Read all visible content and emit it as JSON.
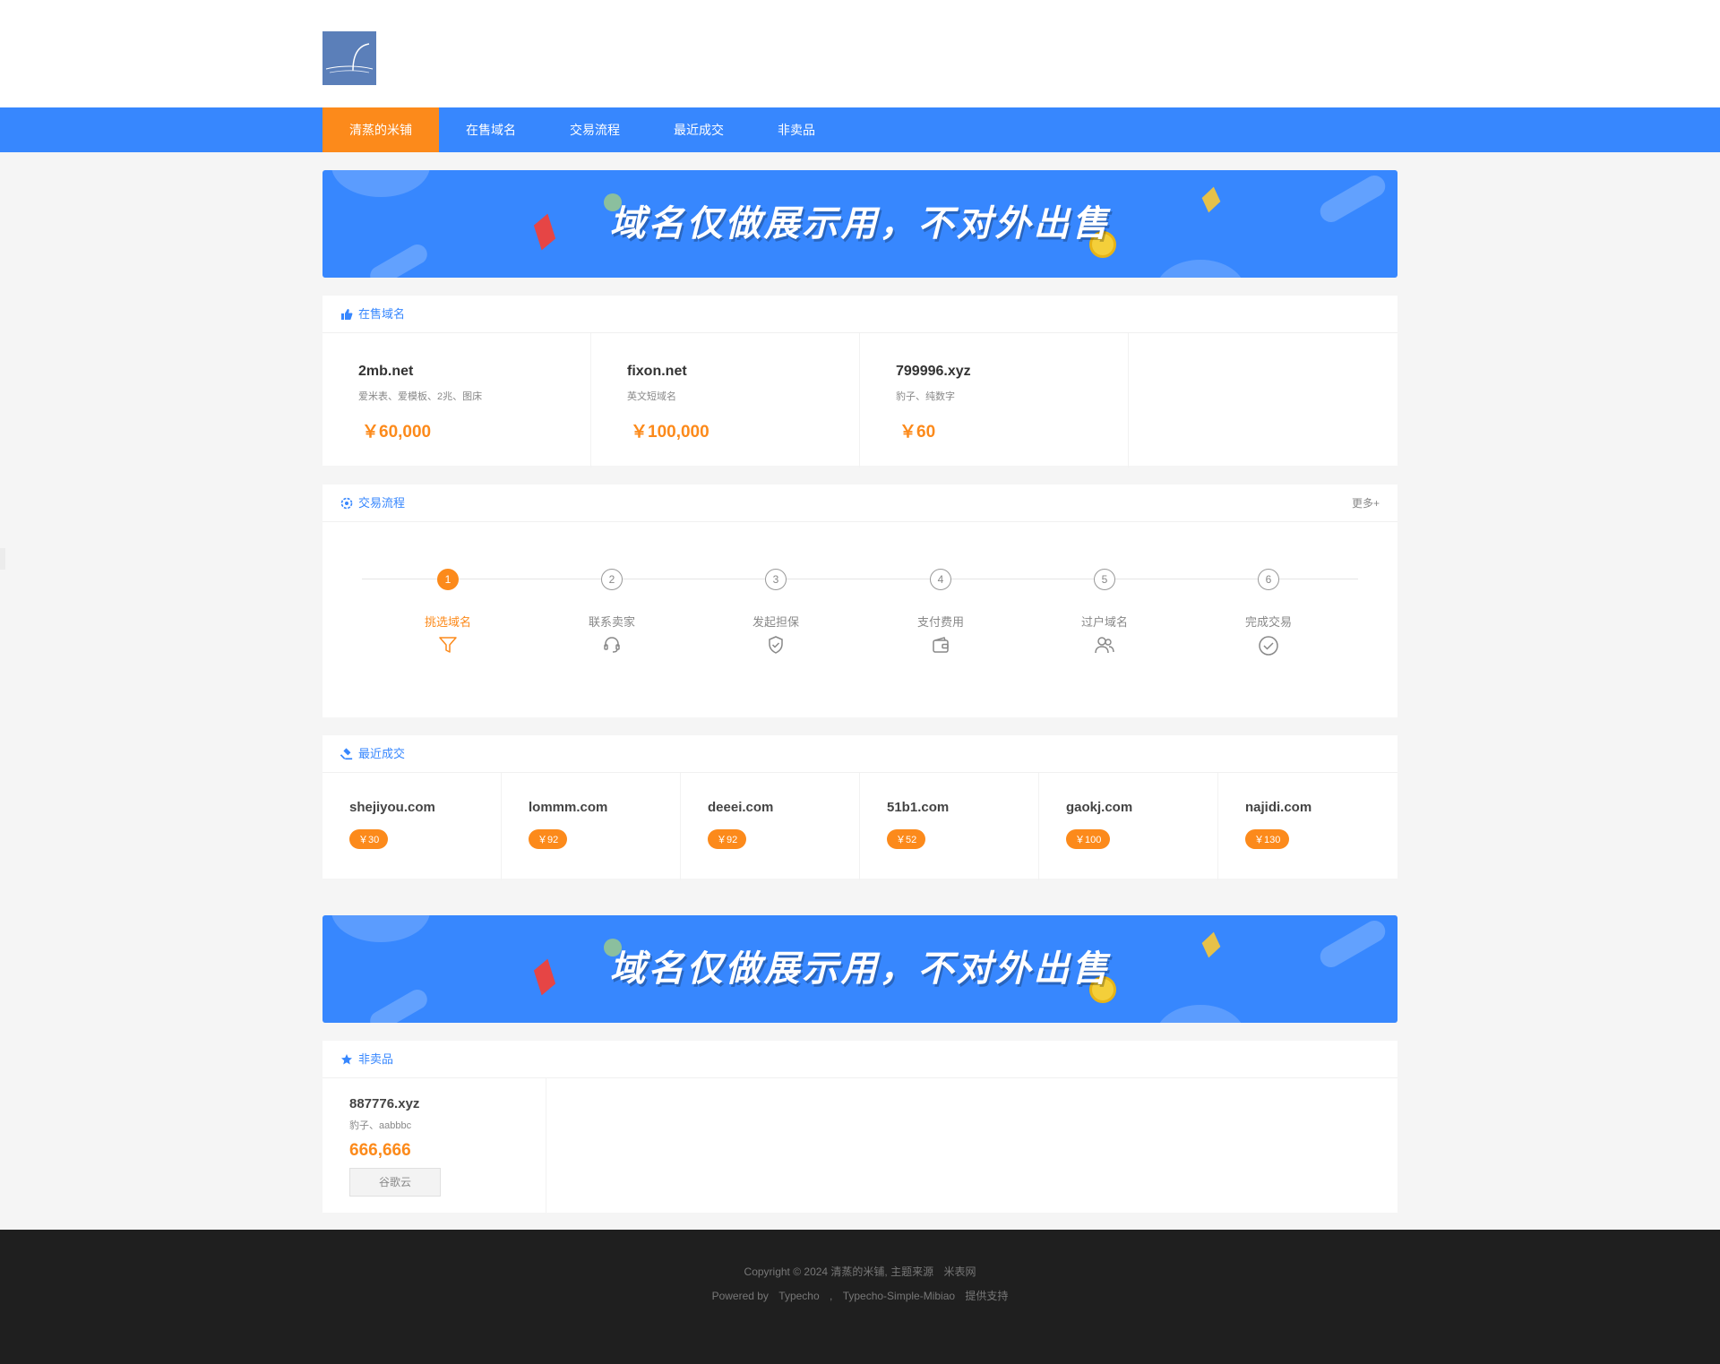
{
  "nav": {
    "items": [
      {
        "label": "清蒸的米铺",
        "active": true
      },
      {
        "label": "在售域名",
        "active": false
      },
      {
        "label": "交易流程",
        "active": false
      },
      {
        "label": "最近成交",
        "active": false
      },
      {
        "label": "非卖品",
        "active": false
      }
    ]
  },
  "banner": {
    "text": "域名仅做展示用，不对外出售"
  },
  "on_sale": {
    "title": "在售域名",
    "items": [
      {
        "name": "2mb.net",
        "desc": "爱米表、爱模板、2兆、图床",
        "price": "￥60,000"
      },
      {
        "name": "fixon.net",
        "desc": "英文短域名",
        "price": "￥100,000"
      },
      {
        "name": "799996.xyz",
        "desc": "豹子、纯数字",
        "price": "￥60"
      }
    ]
  },
  "process": {
    "title": "交易流程",
    "more": "更多+",
    "steps": [
      {
        "num": "1",
        "label": "挑选域名",
        "icon": "funnel-icon",
        "active": true
      },
      {
        "num": "2",
        "label": "联系卖家",
        "icon": "headset-icon",
        "active": false
      },
      {
        "num": "3",
        "label": "发起担保",
        "icon": "shield-icon",
        "active": false
      },
      {
        "num": "4",
        "label": "支付费用",
        "icon": "wallet-icon",
        "active": false
      },
      {
        "num": "5",
        "label": "过户域名",
        "icon": "users-icon",
        "active": false
      },
      {
        "num": "6",
        "label": "完成交易",
        "icon": "check-circle-icon",
        "active": false
      }
    ]
  },
  "recent": {
    "title": "最近成交",
    "items": [
      {
        "name": "shejiyou.com",
        "price": "￥30"
      },
      {
        "name": "lommm.com",
        "price": "￥92"
      },
      {
        "name": "deeei.com",
        "price": "￥92"
      },
      {
        "name": "51b1.com",
        "price": "￥52"
      },
      {
        "name": "gaokj.com",
        "price": "￥100"
      },
      {
        "name": "najidi.com",
        "price": "￥130"
      }
    ]
  },
  "not_for_sale": {
    "title": "非卖品",
    "items": [
      {
        "name": "887776.xyz",
        "desc": "豹子、aabbbc",
        "price": "666,666",
        "button": "谷歌云"
      }
    ]
  },
  "footer": {
    "copyright": "Copyright © 2024 清蒸的米铺, 主题来源",
    "theme_source": "米表网",
    "powered_by": "Powered by",
    "typecho": "Typecho",
    "sep": ",",
    "theme_name": "Typecho-Simple-Mibiao",
    "support": "提供支持"
  },
  "colors": {
    "primary": "#3787fe",
    "accent": "#fc8a1b",
    "footer_bg": "#1f1f1f"
  }
}
